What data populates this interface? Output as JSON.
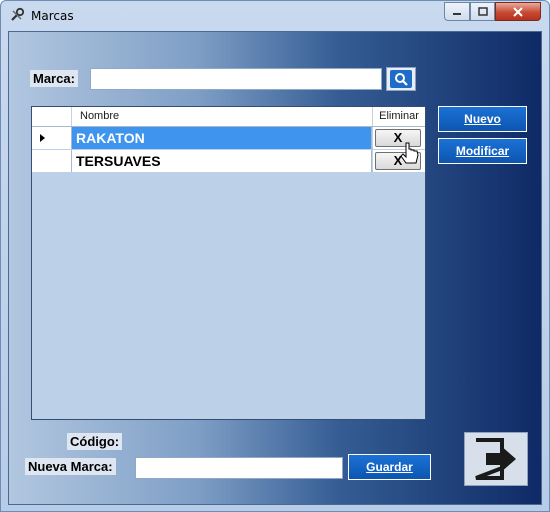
{
  "window": {
    "title": "Marcas",
    "icon": "wrench-screwdriver-icon"
  },
  "search": {
    "label": "Marca:",
    "value": "",
    "button_icon": "search-icon"
  },
  "grid": {
    "columns": [
      "Nombre",
      "Eliminar"
    ],
    "rows": [
      {
        "name": "RAKATON",
        "delete_label": "X",
        "selected": true
      },
      {
        "name": "TERSUAVES",
        "delete_label": "X",
        "selected": false
      }
    ]
  },
  "actions": {
    "nuevo": "Nuevo",
    "modificar": "Modificar"
  },
  "form": {
    "codigo_label": "Código:",
    "codigo_value": "",
    "nueva_marca_label": "Nueva Marca:",
    "nueva_marca_value": "",
    "guardar": "Guardar"
  },
  "exit": {
    "icon": "exit-arrow-icon"
  },
  "colors": {
    "accent_button": "#0d55b0",
    "selected_row": "#3f95ee"
  }
}
